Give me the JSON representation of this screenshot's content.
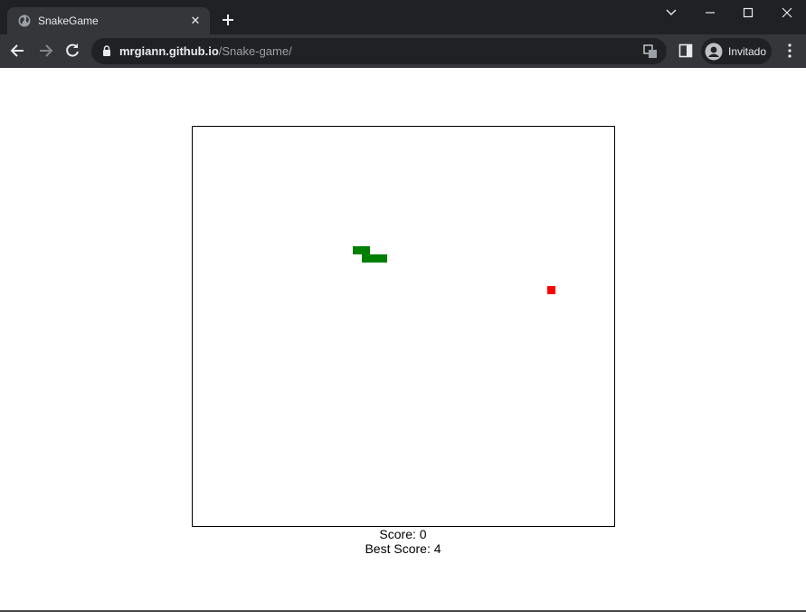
{
  "browser": {
    "tab_title": "SnakeGame",
    "url_host": "mrgiann.github.io",
    "url_path": "/Snake-game/",
    "profile_label": "Invitado"
  },
  "game": {
    "score_text": "Score: 0",
    "best_score_text": "Best Score: 4",
    "snake_color": "#008000",
    "food_color": "#ff0000"
  }
}
